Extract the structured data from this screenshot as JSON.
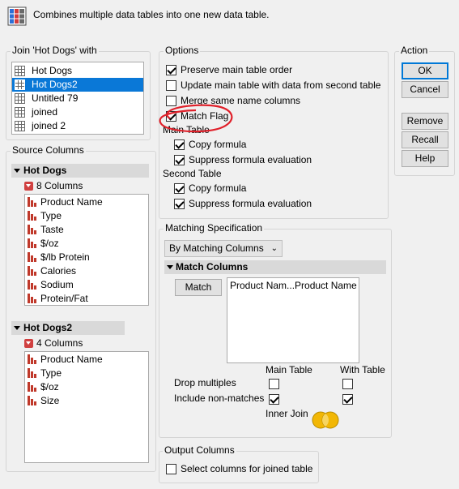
{
  "header": {
    "description": "Combines multiple data tables into one new data table."
  },
  "join_group": {
    "title": "Join 'Hot Dogs' with",
    "tables": [
      "Hot Dogs",
      "Hot Dogs2",
      "Untitled 79",
      "joined",
      "joined 2"
    ],
    "selected": "Hot Dogs2"
  },
  "source": {
    "title": "Source Columns",
    "table1": {
      "name": "Hot Dogs",
      "count": "8 Columns",
      "columns": [
        "Product Name",
        "Type",
        "Taste",
        "$/oz",
        "$/lb Protein",
        "Calories",
        "Sodium",
        "Protein/Fat"
      ]
    },
    "table2": {
      "name": "Hot Dogs2",
      "count": "4 Columns",
      "columns": [
        "Product Name",
        "Type",
        "$/oz",
        "Size"
      ]
    }
  },
  "options": {
    "title": "Options",
    "preserve_order": {
      "label": "Preserve main table order",
      "checked": true
    },
    "update_main": {
      "label": "Update main table with data from second table",
      "checked": false
    },
    "merge_same": {
      "label": "Merge same name columns",
      "checked": false
    },
    "match_flag": {
      "label": "Match Flag",
      "checked": true
    },
    "main_table_label": "Main Table",
    "main_copy": {
      "label": "Copy formula",
      "checked": true
    },
    "main_suppress": {
      "label": "Suppress formula evaluation",
      "checked": true
    },
    "second_table_label": "Second Table",
    "second_copy": {
      "label": "Copy formula",
      "checked": true
    },
    "second_suppress": {
      "label": "Suppress formula evaluation",
      "checked": true
    }
  },
  "matching": {
    "title": "Matching Specification",
    "method": "By Matching Columns",
    "section_title": "Match Columns",
    "match_button": "Match",
    "pairs": [
      "Product Nam...Product Name"
    ],
    "col_main": "Main Table",
    "col_with": "With Table",
    "drop_multiples": {
      "label": "Drop multiples",
      "main": false,
      "with": false
    },
    "include_nonmatches": {
      "label": "Include non-matches",
      "main": true,
      "with": true
    },
    "join_type": "Inner Join"
  },
  "output": {
    "title": "Output Columns",
    "select_columns": {
      "label": "Select columns for joined table",
      "checked": false
    }
  },
  "actions": {
    "title": "Action",
    "ok": "OK",
    "cancel": "Cancel",
    "remove": "Remove",
    "recall": "Recall",
    "help": "Help"
  },
  "colors": {
    "selection": "#0a78d7",
    "annotation": "#e0202a",
    "venn": "#f2b705",
    "column_icon": "#c0392b"
  }
}
